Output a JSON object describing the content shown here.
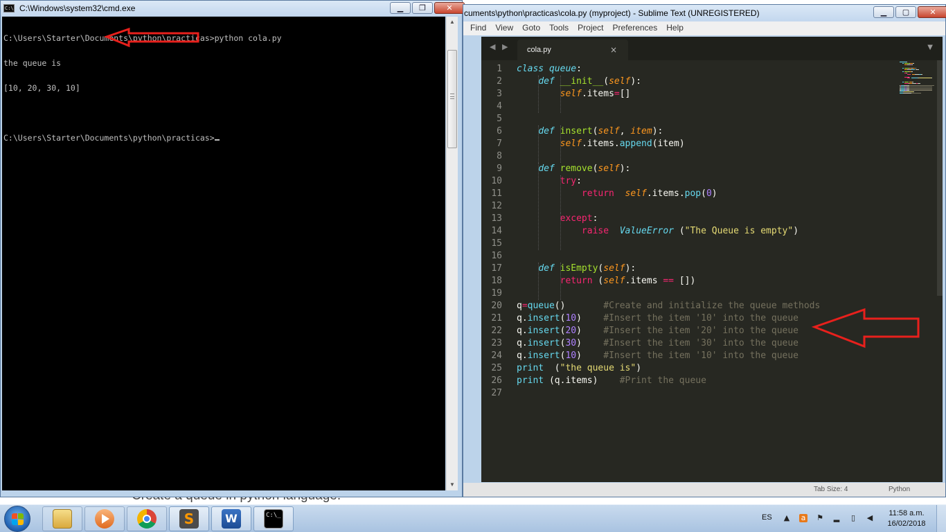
{
  "background": {
    "caption": "Create a queue in python language."
  },
  "cmd": {
    "title": "C:\\Windows\\system32\\cmd.exe",
    "icon": "C:\\",
    "lines": [
      "C:\\Users\\Starter\\Documents\\python\\practicas>python cola.py",
      "the queue is",
      "[10, 20, 30, 10]",
      "",
      "C:\\Users\\Starter\\Documents\\python\\practicas>"
    ]
  },
  "sublime": {
    "title": "cuments\\python\\practicas\\cola.py (myproject) - Sublime Text (UNREGISTERED)",
    "menu": [
      "Find",
      "View",
      "Goto",
      "Tools",
      "Project",
      "Preferences",
      "Help"
    ],
    "tab": {
      "label": "cola.py",
      "close": "×"
    },
    "tab_nav": "◀ ▶",
    "tab_dropdown": "▼",
    "status": {
      "tab_size": "Tab Size: 4",
      "syntax": "Python"
    },
    "lines": [
      [
        [
          "kw",
          "class"
        ],
        [
          "p",
          " "
        ],
        [
          "cls",
          "queue"
        ],
        [
          "p",
          ":"
        ]
      ],
      [
        [
          "p",
          "    "
        ],
        [
          "kw",
          "def"
        ],
        [
          "p",
          " "
        ],
        [
          "fn",
          "__init__"
        ],
        [
          "p",
          "("
        ],
        [
          "self",
          "self"
        ],
        [
          "p",
          "):"
        ]
      ],
      [
        [
          "p",
          "        "
        ],
        [
          "self",
          "self"
        ],
        [
          "p",
          ".items"
        ],
        [
          "red",
          "="
        ],
        [
          "p",
          "[]"
        ]
      ],
      [],
      [],
      [
        [
          "p",
          "    "
        ],
        [
          "kw",
          "def"
        ],
        [
          "p",
          " "
        ],
        [
          "fn",
          "insert"
        ],
        [
          "p",
          "("
        ],
        [
          "self",
          "self"
        ],
        [
          "p",
          ", "
        ],
        [
          "self",
          "item"
        ],
        [
          "p",
          "):"
        ]
      ],
      [
        [
          "p",
          "        "
        ],
        [
          "self",
          "self"
        ],
        [
          "p",
          ".items."
        ],
        [
          "builtin",
          "append"
        ],
        [
          "p",
          "(item)"
        ]
      ],
      [],
      [
        [
          "p",
          "    "
        ],
        [
          "kw",
          "def"
        ],
        [
          "p",
          " "
        ],
        [
          "fn",
          "remove"
        ],
        [
          "p",
          "("
        ],
        [
          "self",
          "self"
        ],
        [
          "p",
          "):"
        ]
      ],
      [
        [
          "p",
          "        "
        ],
        [
          "red",
          "try"
        ],
        [
          "p",
          ":"
        ]
      ],
      [
        [
          "p",
          "            "
        ],
        [
          "red",
          "return"
        ],
        [
          "p",
          "  "
        ],
        [
          "self",
          "self"
        ],
        [
          "p",
          ".items."
        ],
        [
          "builtin",
          "pop"
        ],
        [
          "p",
          "("
        ],
        [
          "num",
          "0"
        ],
        [
          "p",
          ")"
        ]
      ],
      [],
      [
        [
          "p",
          "        "
        ],
        [
          "red",
          "except"
        ],
        [
          "p",
          ":"
        ]
      ],
      [
        [
          "p",
          "            "
        ],
        [
          "red",
          "raise"
        ],
        [
          "p",
          "  "
        ],
        [
          "kw",
          "ValueError"
        ],
        [
          "p",
          " ("
        ],
        [
          "str",
          "\"The Queue is empty\""
        ],
        [
          "p",
          ")"
        ]
      ],
      [],
      [],
      [
        [
          "p",
          "    "
        ],
        [
          "kw",
          "def"
        ],
        [
          "p",
          " "
        ],
        [
          "fn",
          "isEmpty"
        ],
        [
          "p",
          "("
        ],
        [
          "self",
          "self"
        ],
        [
          "p",
          "):"
        ]
      ],
      [
        [
          "p",
          "        "
        ],
        [
          "red",
          "return"
        ],
        [
          "p",
          " ("
        ],
        [
          "self",
          "self"
        ],
        [
          "p",
          ".items "
        ],
        [
          "red",
          "=="
        ],
        [
          "p",
          " [])"
        ]
      ],
      [],
      [
        [
          "p",
          "q"
        ],
        [
          "red",
          "="
        ],
        [
          "builtin",
          "queue"
        ],
        [
          "p",
          "()       "
        ],
        [
          "cmt",
          "#Create and initialize the queue methods"
        ]
      ],
      [
        [
          "p",
          "q."
        ],
        [
          "builtin",
          "insert"
        ],
        [
          "p",
          "("
        ],
        [
          "num",
          "10"
        ],
        [
          "p",
          ")    "
        ],
        [
          "cmt",
          "#Insert the item '10' into the queue"
        ]
      ],
      [
        [
          "p",
          "q."
        ],
        [
          "builtin",
          "insert"
        ],
        [
          "p",
          "("
        ],
        [
          "num",
          "20"
        ],
        [
          "p",
          ")    "
        ],
        [
          "cmt",
          "#Insert the item '20' into the queue"
        ]
      ],
      [
        [
          "p",
          "q."
        ],
        [
          "builtin",
          "insert"
        ],
        [
          "p",
          "("
        ],
        [
          "num",
          "30"
        ],
        [
          "p",
          ")    "
        ],
        [
          "cmt",
          "#Insert the item '30' into the queue"
        ]
      ],
      [
        [
          "p",
          "q."
        ],
        [
          "builtin",
          "insert"
        ],
        [
          "p",
          "("
        ],
        [
          "num",
          "10"
        ],
        [
          "p",
          ")    "
        ],
        [
          "cmt",
          "#Insert the item '10' into the queue"
        ]
      ],
      [
        [
          "builtin",
          "print"
        ],
        [
          "p",
          "  ("
        ],
        [
          "str",
          "\"the queue is\""
        ],
        [
          "p",
          ")"
        ]
      ],
      [
        [
          "builtin",
          "print"
        ],
        [
          "p",
          " (q.items)    "
        ],
        [
          "cmt",
          "#Print the queue"
        ]
      ],
      []
    ]
  },
  "taskbar": {
    "language": "ES",
    "time": "11:58 a.m.",
    "date": "16/02/2018",
    "apps": [
      {
        "name": "file-explorer",
        "running": false
      },
      {
        "name": "media-player",
        "running": false
      },
      {
        "name": "chrome",
        "running": false
      },
      {
        "name": "sublime-text",
        "running": true
      },
      {
        "name": "word",
        "running": true
      },
      {
        "name": "cmd",
        "running": true
      }
    ]
  },
  "colors": {
    "arrow": "#e8201c",
    "editor_bg": "#272822",
    "terminal_bg": "#000000"
  }
}
